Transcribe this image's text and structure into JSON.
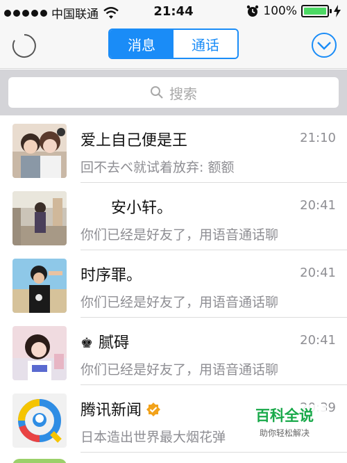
{
  "status_bar": {
    "carrier": "中国联通",
    "time": "21:44",
    "battery_percent": "100%",
    "battery_level": 1.0
  },
  "nav": {
    "tabs": [
      {
        "label": "消息",
        "active": true
      },
      {
        "label": "通话",
        "active": false
      }
    ]
  },
  "search": {
    "placeholder": "搜索"
  },
  "conversations": [
    {
      "name": "爱上自己便是王",
      "time": "21:10",
      "preview": "回不去ベ就试着放弃: 额额"
    },
    {
      "name": "　　安小轩。",
      "time": "20:41",
      "preview": "你们已经是好友了，用语音通话聊"
    },
    {
      "name": "时序罪。",
      "time": "20:41",
      "preview": "你们已经是好友了，用语音通话聊"
    },
    {
      "name": "腻碍",
      "time": "20:41",
      "preview": "你们已经是好友了，用语音通话聊",
      "prefix": "♚"
    },
    {
      "name": "腾讯新闻",
      "time": "20:39",
      "preview": "日本造出世界最大烟花弹",
      "verified": true
    }
  ],
  "watermark": {
    "title": "百科全说",
    "subtitle": "助你轻松解决"
  },
  "colors": {
    "accent": "#1a8cf7",
    "battery": "#4cd964",
    "secondary_text": "#8e8e93",
    "watermark": "#19a94a"
  }
}
